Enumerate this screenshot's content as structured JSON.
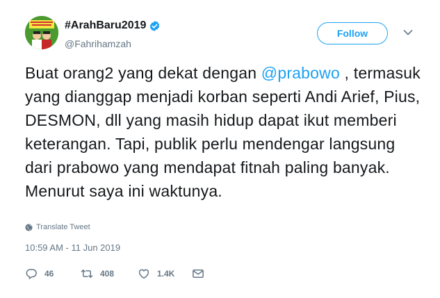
{
  "tweet": {
    "display_name": "#ArahBaru2019",
    "handle": "@Fahrihamzah",
    "follow_label": "Follow",
    "text_before": "Buat orang2 yang dekat dengan ",
    "mention": "@prabowo",
    "text_after": " , termasuk yang dianggap menjadi korban seperti Andi Arief, Pius, DESMON, dll yang masih hidup dapat ikut memberi keterangan. Tapi, publik perlu mendengar langsung dari prabowo yang mendapat fitnah paling banyak. Menurut saya ini waktunya.",
    "translate_label": "Translate Tweet",
    "timestamp": "10:59 AM - 11 Jun 2019",
    "replies": "46",
    "retweets": "408",
    "likes": "1.4K"
  },
  "icons": {
    "verified": "verified-badge-icon",
    "more": "chevron-down-icon",
    "translate": "globe-icon",
    "reply": "reply-icon",
    "retweet": "retweet-icon",
    "like": "heart-icon",
    "dm": "envelope-icon"
  },
  "colors": {
    "accent": "#1da1f2",
    "text": "#14171a",
    "muted": "#657786"
  }
}
